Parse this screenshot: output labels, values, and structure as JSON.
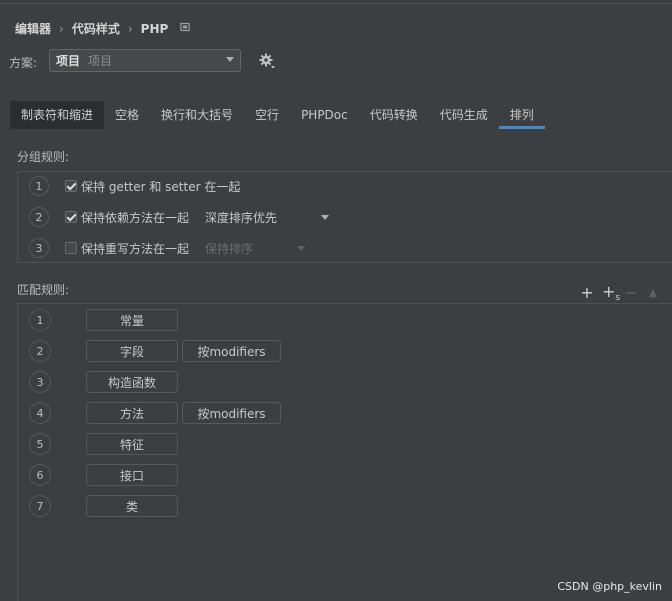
{
  "breadcrumb": [
    "编辑器",
    "代码样式",
    "PHP"
  ],
  "breadcrumb_reset_icon": "reset-icon",
  "scheme": {
    "label": "方案:",
    "value": "项目",
    "sub_value": "项目"
  },
  "tabs": [
    {
      "label": "制表符和缩进"
    },
    {
      "label": "空格"
    },
    {
      "label": "换行和大括号"
    },
    {
      "label": "空行"
    },
    {
      "label": "PHPDoc"
    },
    {
      "label": "代码转换"
    },
    {
      "label": "代码生成"
    },
    {
      "label": "排列"
    }
  ],
  "grouping": {
    "title": "分组规则:",
    "rows": [
      {
        "num": "1",
        "label": "保持 getter 和 setter 在一起",
        "checked": true
      },
      {
        "num": "2",
        "label": "保持依赖方法在一起",
        "checked": true,
        "dropdown": "深度排序优先"
      },
      {
        "num": "3",
        "label": "保持重写方法在一起",
        "checked": false,
        "dropdown": "保持排序"
      }
    ]
  },
  "matching": {
    "title": "匹配规则:",
    "rules": [
      {
        "num": "1",
        "name": "常量"
      },
      {
        "num": "2",
        "name": "字段",
        "modifier": "按modifiers"
      },
      {
        "num": "3",
        "name": "构造函数"
      },
      {
        "num": "4",
        "name": "方法",
        "modifier": "按modifiers"
      },
      {
        "num": "5",
        "name": "特征"
      },
      {
        "num": "6",
        "name": "接口"
      },
      {
        "num": "7",
        "name": "类"
      }
    ],
    "tool_sub": "s"
  },
  "watermark": "CSDN @php_kevlin",
  "colors": {
    "background": "#3c3f41",
    "accent": "#4a88c7",
    "active_tab": "#2b2d2e"
  }
}
